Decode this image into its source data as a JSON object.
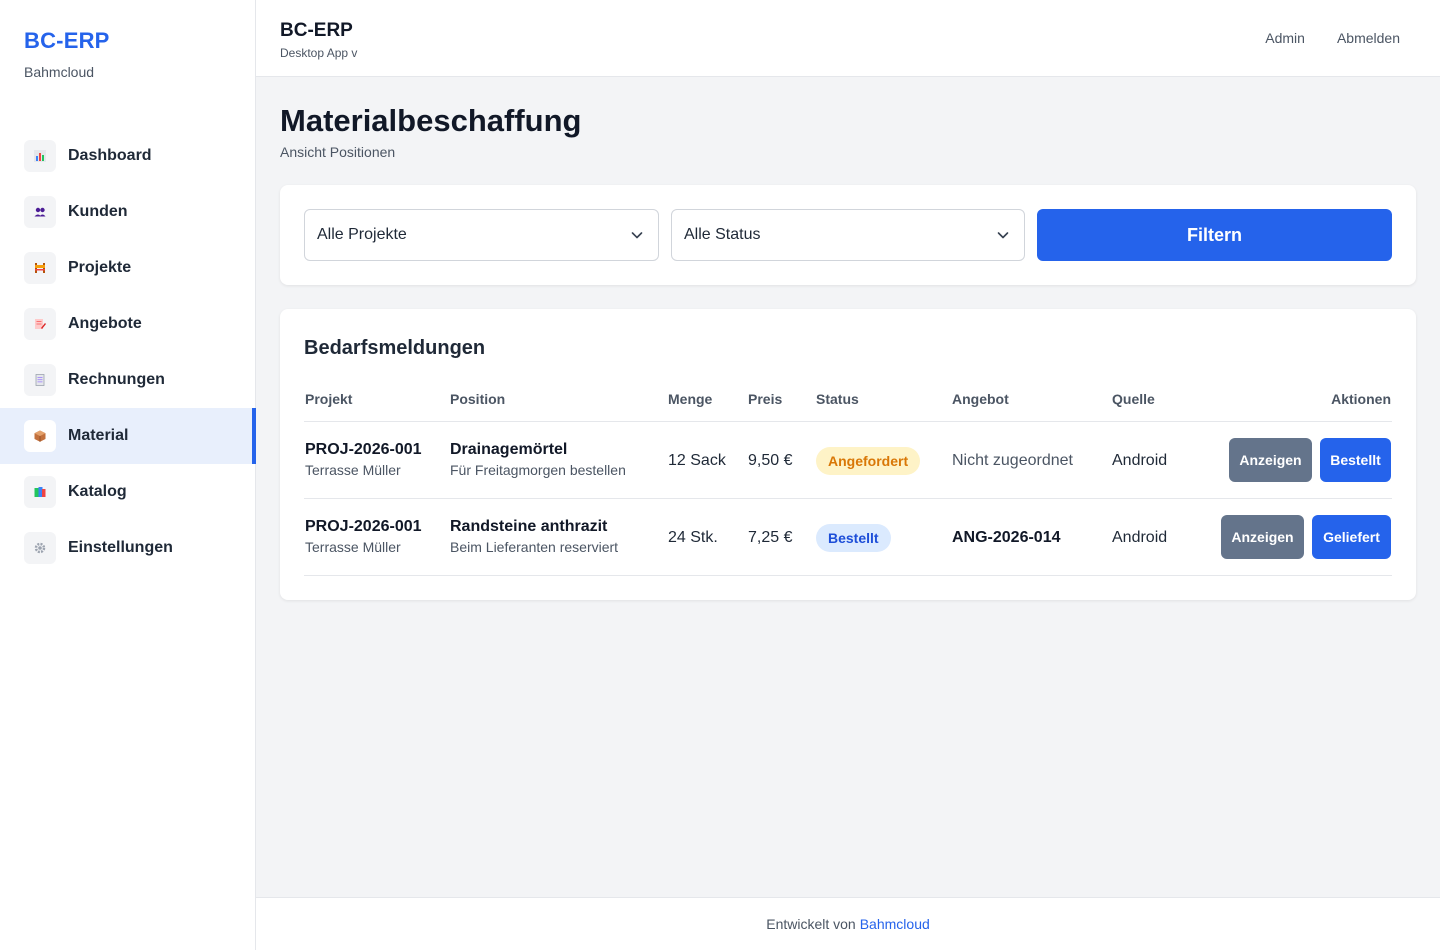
{
  "brand": {
    "name": "BC-ERP",
    "subtitle": "Bahmcloud"
  },
  "nav": [
    {
      "label": "Dashboard",
      "icon": "bar-chart-icon"
    },
    {
      "label": "Kunden",
      "icon": "users-icon"
    },
    {
      "label": "Projekte",
      "icon": "construction-icon"
    },
    {
      "label": "Angebote",
      "icon": "document-pen-icon"
    },
    {
      "label": "Rechnungen",
      "icon": "receipt-icon"
    },
    {
      "label": "Material",
      "icon": "package-icon",
      "active": true
    },
    {
      "label": "Katalog",
      "icon": "books-icon"
    },
    {
      "label": "Einstellungen",
      "icon": "gear-icon"
    }
  ],
  "header": {
    "title": "BC-ERP",
    "subtitle": "Desktop App v",
    "links": [
      "Admin",
      "Abmelden"
    ]
  },
  "page": {
    "title": "Materialbeschaffung",
    "subtitle": "Ansicht Positionen"
  },
  "filters": {
    "project_select": "Alle Projekte",
    "status_select": "Alle Status",
    "button": "Filtern"
  },
  "table": {
    "title": "Bedarfsmeldungen",
    "columns": [
      "Projekt",
      "Position",
      "Menge",
      "Preis",
      "Status",
      "Angebot",
      "Quelle",
      "Aktionen"
    ],
    "rows": [
      {
        "project": "PROJ-2026-001",
        "project_sub": "Terrasse Müller",
        "position": "Drainagemörtel",
        "position_sub": "Für Freitagmorgen bestellen",
        "qty": "12 Sack",
        "price": "9,50 €",
        "status": "Angefordert",
        "status_kind": "requested",
        "offer": "Nicht zugeordnet",
        "source": "Android",
        "actions": [
          "Anzeigen",
          "Bestellt"
        ]
      },
      {
        "project": "PROJ-2026-001",
        "project_sub": "Terrasse Müller",
        "position": "Randsteine anthrazit",
        "position_sub": "Beim Lieferanten reserviert",
        "qty": "24 Stk.",
        "price": "7,25 €",
        "status": "Bestellt",
        "status_kind": "ordered",
        "offer": "ANG-2026-014",
        "source": "Android",
        "actions": [
          "Anzeigen",
          "Geliefert"
        ]
      }
    ]
  },
  "footer": {
    "text": "Entwickelt von",
    "link": "Bahmcloud"
  },
  "colors": {
    "accent": "#2563eb",
    "requested": "#d97706",
    "ordered": "#1d4ed8",
    "secondary_button": "#64748b"
  }
}
